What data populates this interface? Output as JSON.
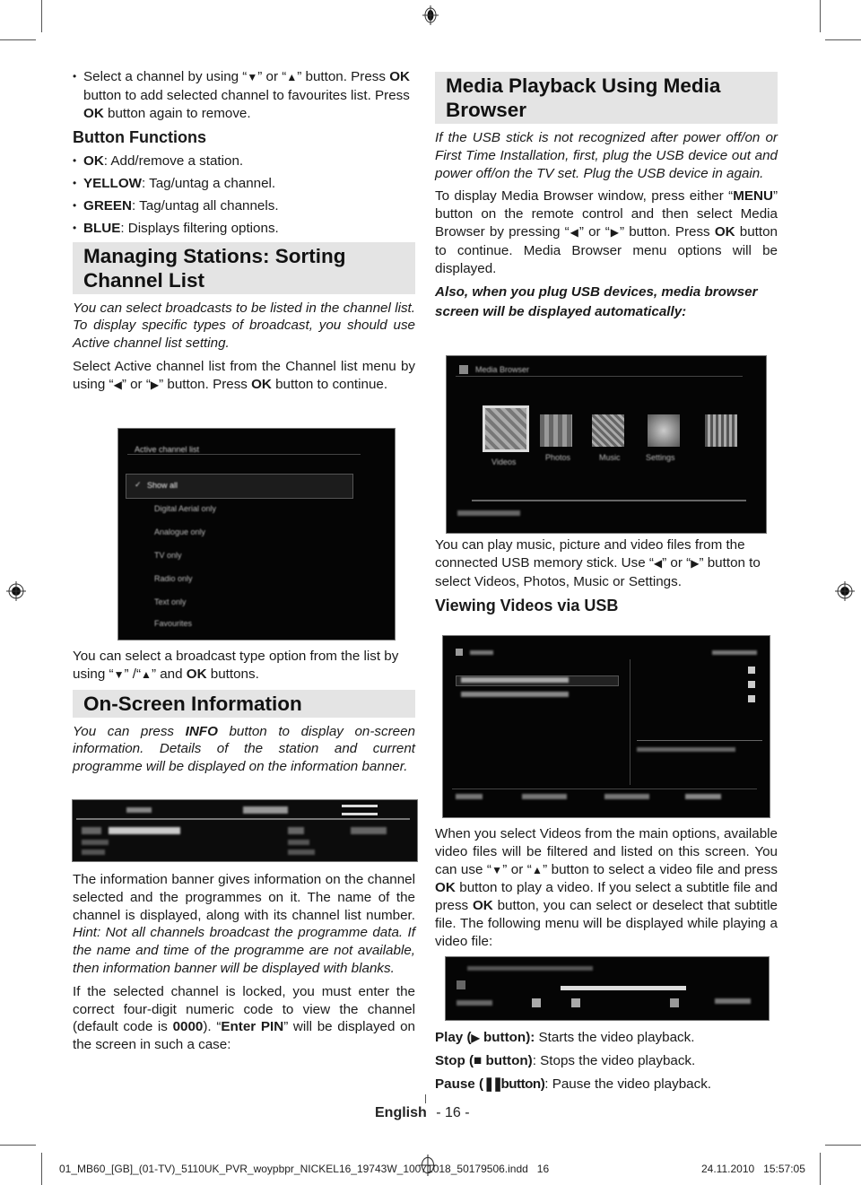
{
  "left_column": {
    "intro_bullet": {
      "p1": "Select a channel by using “",
      "down": "▼",
      "p2": "” or “",
      "up": "▲",
      "p3": "” button. Press ",
      "ok1": "OK",
      "p4": " button to add selected channel to favourites list. Press ",
      "ok2": "OK",
      "p5": " button again to remove."
    },
    "button_functions": {
      "heading": "Button Functions",
      "items": [
        {
          "key": "OK",
          "text": ": Add/remove a station."
        },
        {
          "key": "YELLOW",
          "text": ": Tag/untag a channel."
        },
        {
          "key": "GREEN",
          "text": ": Tag/untag all channels."
        },
        {
          "key": "BLUE",
          "text": ": Displays filtering options."
        }
      ]
    },
    "sorting": {
      "heading": "Managing Stations: Sorting Channel List",
      "italic_para": "You can select broadcasts to be listed in the channel list. To display specific types of broadcast, you should use Active channel list setting.",
      "para_a": "Select Active channel list from the Channel list menu by using “",
      "left": "◀",
      "para_b": "” or “",
      "right": "▶",
      "para_c": "” button. Press ",
      "ok": "OK",
      "para_d": " button to continue."
    },
    "active_list_screen": {
      "title": "Active channel list",
      "options": [
        "Show all",
        "Digital Aerial only",
        "Analogue only",
        "TV only",
        "Radio only",
        "Text only",
        "Favourites"
      ],
      "selected": "Show all"
    },
    "broadcast_type": {
      "p1": "You can select a broadcast type option from the list by using “",
      "down": "▼",
      "p2": "” /“",
      "up": "▲",
      "p3": "” and ",
      "ok": "OK",
      "p4": " buttons."
    },
    "onscreen": {
      "heading": "On-Screen Information",
      "p1": "You can press ",
      "info": "INFO",
      "p2": " button to display on-screen information. Details of the station and current programme will be displayed on the information banner."
    },
    "banner_para": {
      "normal": "The information banner gives information on the channel selected and the programmes on it. The name of the channel is displayed, along with its channel list number. ",
      "hint": "Hint: Not all channels broadcast the programme data. If the name and time of the programme are not available, then information banner will be displayed with blanks."
    },
    "locked_para": {
      "p1": "If the selected channel is locked, you must enter the correct four-digit numeric code to view the channel (default code is ",
      "code": "0000",
      "p2": "). “",
      "pin": "Enter PIN",
      "p3": "” will be displayed on the screen in such a case:"
    }
  },
  "right_column": {
    "media": {
      "heading": "Media Playback Using Media Browser",
      "italic_para": "If the USB stick is not recognized after power off/on or First Time Installation, first, plug the USB device out and power off/on the TV set. Plug the USB device in again.",
      "p1": "To display Media Browser window, press either “",
      "menu": "MENU",
      "p2": "” button on the remote control and then select Media Browser by pressing “",
      "left": "◀",
      "p3": "” or “",
      "right": "▶",
      "p4": "” button. Press ",
      "ok": "OK",
      "p5": " button to continue. Media Browser menu options will be displayed.",
      "bold_italic": "Also, when you plug USB devices, media browser screen will be displayed automatically:"
    },
    "media_browser_screen": {
      "title": "Media Browser",
      "options": [
        "Videos",
        "Photos",
        "Music",
        "Settings"
      ]
    },
    "usb_para": {
      "p1": "You can play music, picture and video files from the connected USB memory stick. Use “",
      "left": "◀",
      "p2": "” or “",
      "right": "▶",
      "p3": "” button to select Videos, Photos, Music or Settings."
    },
    "videos": {
      "heading": "Viewing Videos via USB",
      "p1": "When you select Videos from the main options, available video files will be filtered and listed on this screen. You can use “",
      "down": "▼",
      "p2": "” or “",
      "up": "▲",
      "p3": "” button to select a video file and press ",
      "ok1": "OK",
      "p4": " button to play a video. If you select a subtitle file and press ",
      "ok2": "OK",
      "p5": " button, you can select or deselect that subtitle file. The following menu will be displayed while playing a video file:"
    },
    "controls": [
      {
        "label": "Play (",
        "icon": "▶",
        "label2": " button):",
        "desc": " Starts the video playback."
      },
      {
        "label": "Stop (",
        "icon": "■",
        "label2": " button)",
        "desc": ": Stops the video playback."
      },
      {
        "label": "Pause (",
        "icon": "❚❚",
        "label2": "button)",
        "desc": ": Pause the video playback."
      }
    ]
  },
  "footer": {
    "language": "English",
    "page": "- 16 -",
    "slug_file": "01_MB60_[GB]_(01-TV)_5110UK_PVR_woypbpr_NICKEL16_19743W_10071018_50179506.indd   16",
    "slug_date": "24.11.2010   15:57:05"
  }
}
